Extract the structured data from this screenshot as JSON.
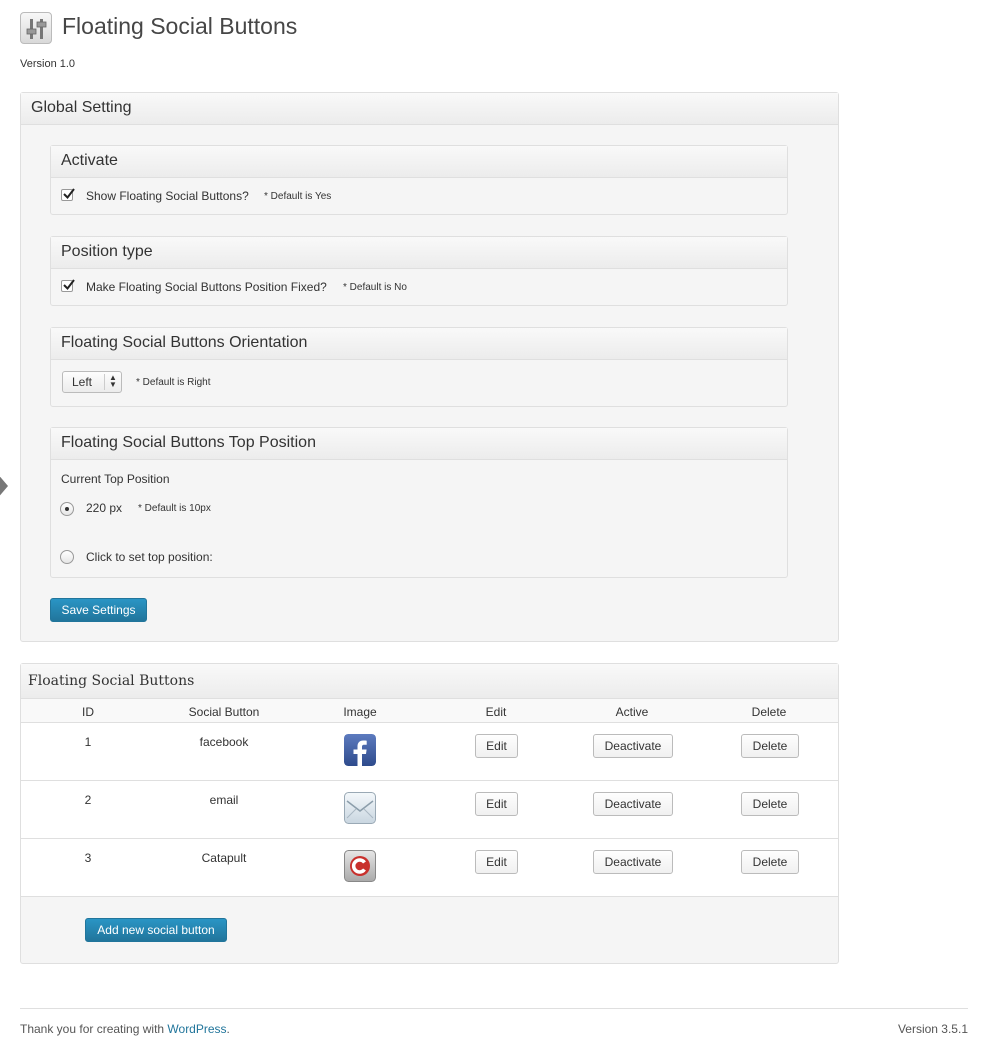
{
  "header": {
    "title": "Floating Social Buttons",
    "version": "Version 1.0"
  },
  "global": {
    "title": "Global Setting",
    "activate": {
      "title": "Activate",
      "label": "Show Floating Social Buttons?",
      "checked": true,
      "note": "* Default is Yes"
    },
    "position_type": {
      "title": "Position type",
      "label": "Make Floating Social Buttons Position Fixed?",
      "checked": true,
      "note": "* Default is No"
    },
    "orientation": {
      "title": "Floating Social Buttons Orientation",
      "selected": "Left",
      "note": "* Default is Right"
    },
    "top_position": {
      "title": "Floating Social Buttons Top Position",
      "current_label": "Current Top Position",
      "current_value": "220 px",
      "note": "* Default is 10px",
      "set_label": "Click to set top position:"
    },
    "save_label": "Save Settings"
  },
  "buttons_table": {
    "title": "Floating Social Buttons",
    "columns": [
      "ID",
      "Social Button",
      "Image",
      "Edit",
      "Active",
      "Delete"
    ],
    "rows": [
      {
        "id": "1",
        "name": "facebook",
        "icon": "facebook-icon",
        "edit": "Edit",
        "active": "Deactivate",
        "delete": "Delete"
      },
      {
        "id": "2",
        "name": "email",
        "icon": "email-icon",
        "edit": "Edit",
        "active": "Deactivate",
        "delete": "Delete"
      },
      {
        "id": "3",
        "name": "Catapult",
        "icon": "catapult-icon",
        "edit": "Edit",
        "active": "Deactivate",
        "delete": "Delete"
      }
    ],
    "add_label": "Add new social button"
  },
  "footer": {
    "thanks_prefix": "Thank you for creating with ",
    "thanks_link": "WordPress",
    "thanks_suffix": ".",
    "version": "Version 3.5.1"
  },
  "colors": {
    "primary_button": "#21759b",
    "link": "#21759b",
    "panel_bg": "#f5f5f5"
  }
}
